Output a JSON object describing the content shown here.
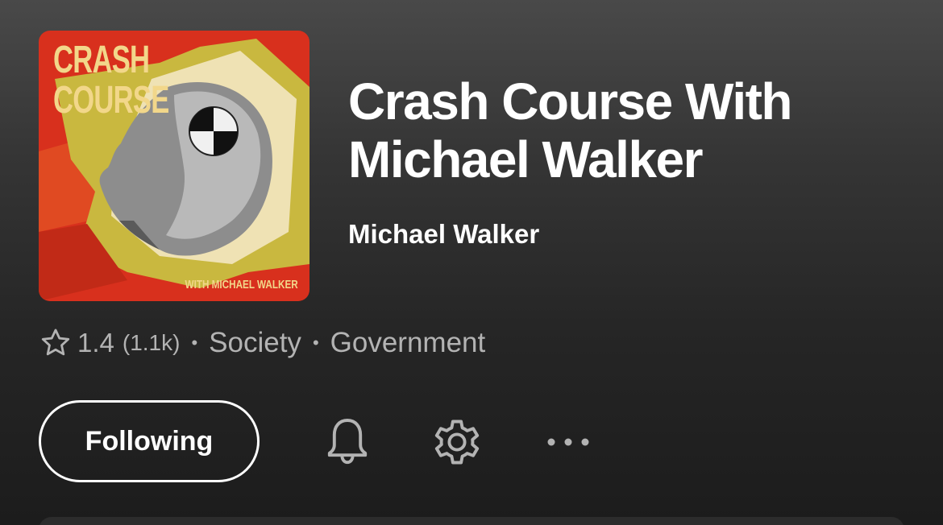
{
  "podcast": {
    "cover_title": "CRASH\nCOURSE",
    "cover_subtitle": "WITH MICHAEL WALKER",
    "title": "Crash Course With Michael Walker",
    "publisher": "Michael Walker",
    "rating": "1.4",
    "rating_count": "(1.1k)",
    "categories": [
      "Society",
      "Government"
    ],
    "separator": "•"
  },
  "actions": {
    "follow_label": "Following"
  },
  "icons": [
    "star-icon",
    "bell-icon",
    "gear-icon",
    "more-icon"
  ],
  "colors": {
    "text_primary": "#ffffff",
    "text_secondary": "#b3b3b3",
    "cover_red": "#d8301d",
    "cover_yellow": "#e6cf54",
    "cover_text": "#f2d78a"
  }
}
